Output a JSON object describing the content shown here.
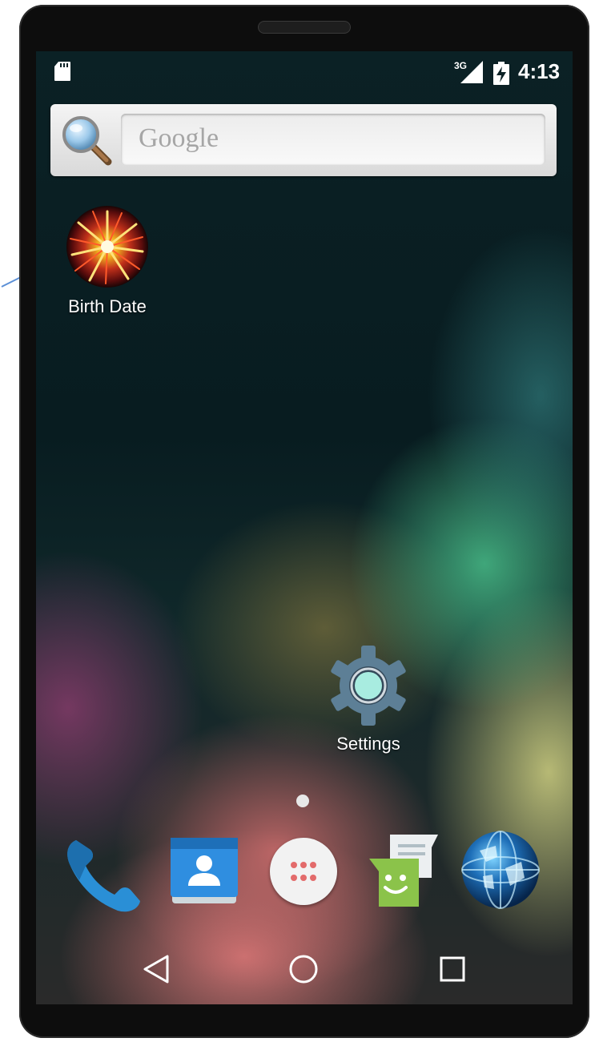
{
  "status_bar": {
    "network_type": "3G",
    "time": "4:13",
    "icons": [
      "sd-card-icon",
      "signal-icon",
      "battery-charging-icon"
    ]
  },
  "search": {
    "placeholder": "Google",
    "icon": "magnifier-icon"
  },
  "home_apps": [
    {
      "label": "Birth Date",
      "icon": "firework-icon"
    },
    {
      "label": "Settings",
      "icon": "gear-icon"
    }
  ],
  "dock": [
    {
      "name": "Phone",
      "icon": "phone-icon"
    },
    {
      "name": "Contacts",
      "icon": "contacts-icon"
    },
    {
      "name": "All Apps",
      "icon": "app-drawer-icon"
    },
    {
      "name": "Messaging",
      "icon": "messaging-icon"
    },
    {
      "name": "Browser",
      "icon": "globe-icon"
    }
  ],
  "navigation": {
    "buttons": [
      "back-icon",
      "home-icon",
      "recents-icon"
    ]
  },
  "colors": {
    "phone_body": "#0d0d0d",
    "wallpaper_dark": "#0b2125",
    "annotation_arrow": "#5b8fd6"
  }
}
